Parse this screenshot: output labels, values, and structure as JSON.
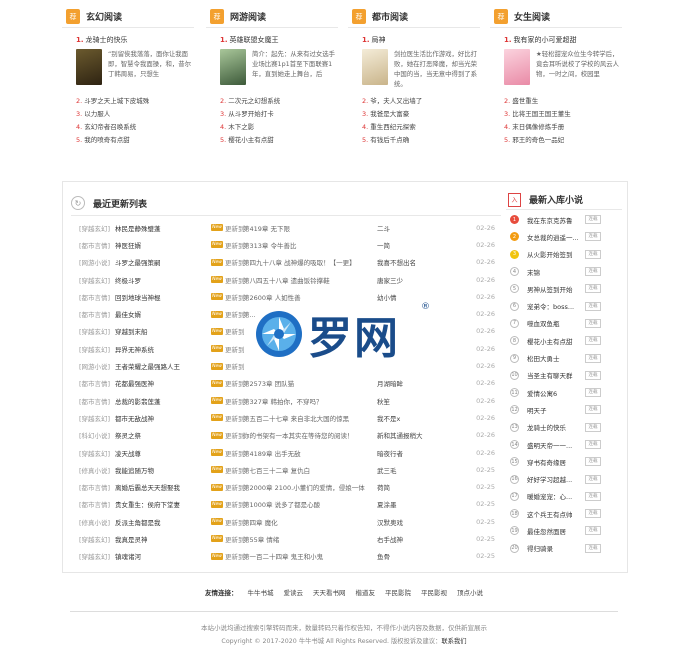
{
  "genres": [
    {
      "title": "玄幻阅读",
      "top_rank": "1.",
      "top_book": "龙骑士的快乐",
      "cover_color": "#4a3a20",
      "desc": "“别留俟我落落，面你让我面即，智慧令我面操，和，昔尔丁韩周易，只想生",
      "list": [
        {
          "rank": "2.",
          "name": "斗罗之天上城下皮城殊"
        },
        {
          "rank": "3.",
          "name": "以力服人"
        },
        {
          "rank": "4.",
          "name": "玄幻帝者召唤系统"
        },
        {
          "rank": "5.",
          "name": "我的喷奇有点甜"
        }
      ]
    },
    {
      "title": "网游阅读",
      "top_rank": "1.",
      "top_book": "英雄联盟女魔王",
      "cover_color": "#6a8a5a",
      "desc": "简介：起先：从来有过女选手业场比赛1p1首至下面联赛1年，直到她走上舞台，后",
      "list": [
        {
          "rank": "2.",
          "name": "二次元之幻想系统"
        },
        {
          "rank": "3.",
          "name": "从斗罗开始打卡"
        },
        {
          "rank": "4.",
          "name": "木下之影"
        },
        {
          "rank": "5.",
          "name": "樱花小主有点甜"
        }
      ]
    },
    {
      "title": "都市阅读",
      "top_rank": "1.",
      "top_book": "局神",
      "cover_color": "#e9ddc0",
      "desc": "剑拉医生活比作游戏，好比打败，她在打恶降魔，却当光荣中国的当，当无意中得到了系统。",
      "list": [
        {
          "rank": "2.",
          "name": "爷，夫人又出墙了"
        },
        {
          "rank": "3.",
          "name": "我爸是大富豪"
        },
        {
          "rank": "4.",
          "name": "重生西纪元探索"
        },
        {
          "rank": "5.",
          "name": "有钱后千点确"
        }
      ]
    },
    {
      "title": "女生阅读",
      "top_rank": "1.",
      "top_book": "我有家的小可爱超甜",
      "cover_color": "#f2b8c8",
      "desc": "★轻松甜宠众位生今转学后，竟会耳听说校了学校的风云人物，一时之间，校园里",
      "list": [
        {
          "rank": "2.",
          "name": "盛世重生"
        },
        {
          "rank": "3.",
          "name": "比将王国王国王董生"
        },
        {
          "rank": "4.",
          "name": "末日偶像修炼手册"
        },
        {
          "rank": "5.",
          "name": "邪王的奇色一品妃"
        }
      ]
    }
  ],
  "updates": {
    "title": "最近更新列表",
    "new_tag": "New",
    "update_label": "更新到",
    "rows": [
      {
        "cat": "[穿越玄幻]",
        "name": "林民是静殊璧蓬",
        "chap": "第419章 无下限",
        "author": "二斗",
        "date": "02-26"
      },
      {
        "cat": "[都市言情]",
        "name": "神医狂婿",
        "chap": "第313章 令牛善比",
        "author": "一简",
        "date": "02-26"
      },
      {
        "cat": "[网游小说]",
        "name": "斗罗之最强策嗣",
        "chap": "第四九十八章 战神爆的吸取！【一更】",
        "author": "我喜不想出名",
        "date": "02-26"
      },
      {
        "cat": "[穿越玄幻]",
        "name": "终极斗罗",
        "chap": "第八四五十八章 遗曲饭铃撑鞋",
        "author": "唐家三少",
        "date": "02-26"
      },
      {
        "cat": "[都市言情]",
        "name": "回到地球当神棍",
        "chap": "第2600章 人如性善",
        "author": "幼小情",
        "date": "02-26"
      },
      {
        "cat": "[都市言情]",
        "name": "最佳女婿",
        "chap": "第...",
        "author": "",
        "date": "02-26"
      },
      {
        "cat": "[穿越玄幻]",
        "name": "穿越到末船",
        "chap": "",
        "author": "",
        "date": "02-26"
      },
      {
        "cat": "[穿越玄幻]",
        "name": "异界无神系统",
        "chap": "",
        "author": "",
        "date": "02-26"
      },
      {
        "cat": "[网游小说]",
        "name": "王者荣耀之最强路人王",
        "chap": "",
        "author": "",
        "date": "02-26"
      },
      {
        "cat": "[都市言情]",
        "name": "花都最强医神",
        "chap": "第2573章 团队猫",
        "author": "月湖暗眸",
        "date": "02-26"
      },
      {
        "cat": "[都市言情]",
        "name": "总裁的影翡莲蓬",
        "chap": "第327章 韩拍你，不穿吗？",
        "author": "秋笙",
        "date": "02-26"
      },
      {
        "cat": "[穿越玄幻]",
        "name": "都市无敌战神",
        "chap": "第五百二十七章 来自非北大国的惊黑",
        "author": "我不是x",
        "date": "02-26"
      },
      {
        "cat": "[科幻小说]",
        "name": "祭灵之祭",
        "chap": "你的书架有一本其实在等待您的阅读！",
        "author": "新和其通报稍大",
        "date": "02-26"
      },
      {
        "cat": "[穿越玄幻]",
        "name": "凌天战尊",
        "chap": "第4189章 出手无敌",
        "author": "暗夜行者",
        "date": "02-26"
      },
      {
        "cat": "[修真小说]",
        "name": "我能追随万物",
        "chap": "第七百三十二章 复仇白",
        "author": "武三毛",
        "date": "02-25"
      },
      {
        "cat": "[都市言情]",
        "name": "离婚后霸总天天想娶我",
        "chap": "第2000章 2100.小董们的爱情，侵娘一体",
        "author": "荷简",
        "date": "02-25"
      },
      {
        "cat": "[都市言情]",
        "name": "贵女重生：侯府下堂妻",
        "chap": "第1000章 说多了都是心酸",
        "author": "夏涂墨",
        "date": "02-25"
      },
      {
        "cat": "[修真小说]",
        "name": "反派主角都是我",
        "chap": "第四章 魔化",
        "author": "汉默奥戏",
        "date": "02-25"
      },
      {
        "cat": "[穿越玄幻]",
        "name": "我真是灵神",
        "chap": "第55章 情绪",
        "author": "右手战神",
        "date": "02-25"
      },
      {
        "cat": "[穿越玄幻]",
        "name": "镇魂诸河",
        "chap": "第一百二十四章 鬼王和小鬼",
        "author": "鱼骨",
        "date": "02-25"
      }
    ]
  },
  "newbooks": {
    "badge": "入",
    "title": "最新入库小说",
    "btn_label": "连载",
    "rows": [
      {
        "n": "1",
        "name": "我在东京克苏鲁"
      },
      {
        "n": "2",
        "name": "女总裁的逍遥一..."
      },
      {
        "n": "3",
        "name": "从火影开始签到"
      },
      {
        "n": "4",
        "name": "末锦"
      },
      {
        "n": "5",
        "name": "男神从签到开始"
      },
      {
        "n": "6",
        "name": "宠弟令：boss..."
      },
      {
        "n": "7",
        "name": "噬血双鱼瓶"
      },
      {
        "n": "8",
        "name": "樱花小主有点甜"
      },
      {
        "n": "9",
        "name": "松田大勇士"
      },
      {
        "n": "10",
        "name": "当圣主有聊天群"
      },
      {
        "n": "11",
        "name": "爱情公寓6"
      },
      {
        "n": "12",
        "name": "明天子"
      },
      {
        "n": "13",
        "name": "龙骑士的快乐"
      },
      {
        "n": "14",
        "name": "盛明天帝一一..."
      },
      {
        "n": "15",
        "name": "穿书有奇缘居"
      },
      {
        "n": "16",
        "name": "好好学习超越..."
      },
      {
        "n": "17",
        "name": "暖婚宠宠：心..."
      },
      {
        "n": "18",
        "name": "这个兵王有点帅"
      },
      {
        "n": "19",
        "name": "最佳忽然面居"
      },
      {
        "n": "20",
        "name": "得归骑录"
      }
    ]
  },
  "watermark": {
    "text": "罗网",
    "reg": "®"
  },
  "links": {
    "title": "友情连接：",
    "items": [
      "牛牛书城",
      "爱读云",
      "天天看书网",
      "楷道友",
      "平民影院",
      "平民影视",
      "顶点小说"
    ]
  },
  "footer": {
    "line1": "本站小说均通过搜索引擎转码而来，数量转码只着作权告知，不得作小说内容及数据，仅供新宣展示",
    "line2_prefix": "Copyright © 2017-2020 牛牛书城 All Rights Reserved. 版权投诉及建议：",
    "line2_link": "联系我们"
  }
}
